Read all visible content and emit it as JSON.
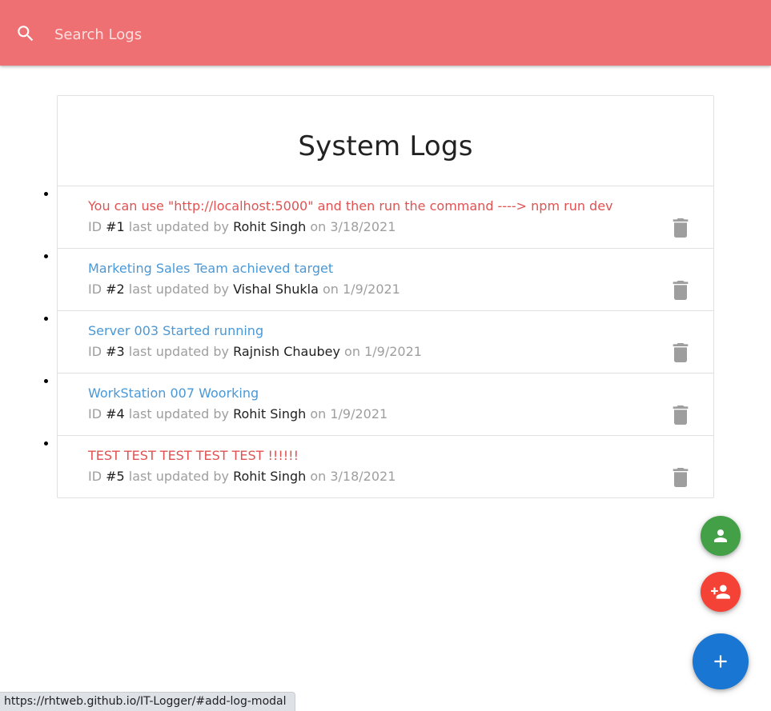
{
  "search": {
    "placeholder": "Search Logs",
    "icon": "search-icon"
  },
  "colors": {
    "navbar": "#ef7073",
    "attention_message": "#e05252",
    "normal_message": "#4a98d6",
    "meta_text": "#9e9e9e",
    "fab_green": "#43a047",
    "fab_red": "#f44336",
    "fab_blue": "#1976d2"
  },
  "main": {
    "title": "System Logs",
    "logs": [
      {
        "message": "You can use \"http://localhost:5000\" and then run the command ----> npm run dev",
        "attention": true,
        "id_prefix": "ID ",
        "id": "#1",
        "updated_by_text": " last updated by ",
        "tech": "Rohit Singh",
        "on_text": " on ",
        "date": "3/18/2021"
      },
      {
        "message": "Marketing Sales Team achieved target",
        "attention": false,
        "id_prefix": "ID ",
        "id": "#2",
        "updated_by_text": " last updated by ",
        "tech": "Vishal Shukla",
        "on_text": " on ",
        "date": "1/9/2021"
      },
      {
        "message": "Server 003 Started running",
        "attention": false,
        "id_prefix": "ID ",
        "id": "#3",
        "updated_by_text": " last updated by ",
        "tech": "Rajnish Chaubey",
        "on_text": " on ",
        "date": "1/9/2021"
      },
      {
        "message": "WorkStation 007 Woorking",
        "attention": false,
        "id_prefix": "ID ",
        "id": "#4",
        "updated_by_text": " last updated by ",
        "tech": "Rohit Singh",
        "on_text": " on ",
        "date": "1/9/2021"
      },
      {
        "message": "TEST TEST TEST TEST TEST !!!!!!",
        "attention": true,
        "id_prefix": "ID ",
        "id": "#5",
        "updated_by_text": " last updated by ",
        "tech": "Rohit Singh",
        "on_text": " on ",
        "date": "3/18/2021"
      }
    ]
  },
  "fabs": [
    {
      "icon": "person-icon",
      "color": "#43a047"
    },
    {
      "icon": "person-add-icon",
      "color": "#f44336"
    },
    {
      "icon": "add-icon",
      "color": "#1976d2"
    }
  ],
  "status_bar": {
    "url": "https://rhtweb.github.io/IT-Logger/#add-log-modal"
  }
}
